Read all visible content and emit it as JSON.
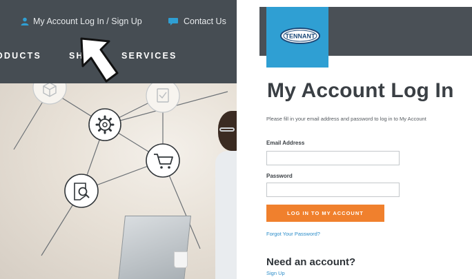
{
  "left": {
    "top_links": {
      "account": "My Account Log In / Sign Up",
      "contact": "Contact Us"
    },
    "nav": {
      "products": "ODUCTS",
      "shop": "SH",
      "services": "SERVICES"
    },
    "hero": {
      "icons": [
        "cube-icon",
        "clipboard-icon",
        "gear-icon",
        "cart-icon",
        "search-document-icon"
      ]
    }
  },
  "right": {
    "logo_text": "TENNANT",
    "title": "My Account Log In",
    "intro": "Please fill in your email address and password to log in to My Account",
    "email_label": "Email Address",
    "email_value": "",
    "password_label": "Password",
    "password_value": "",
    "login_button": "LOG IN TO MY ACCOUNT",
    "forgot_link": "Forgot Your Password?",
    "need_account": "Need an account?",
    "signup_link": "Sign Up"
  },
  "colors": {
    "header": "#464d53",
    "accent_blue": "#2f9fd3",
    "button_orange": "#f0802d",
    "link_blue": "#2a8cc9"
  }
}
